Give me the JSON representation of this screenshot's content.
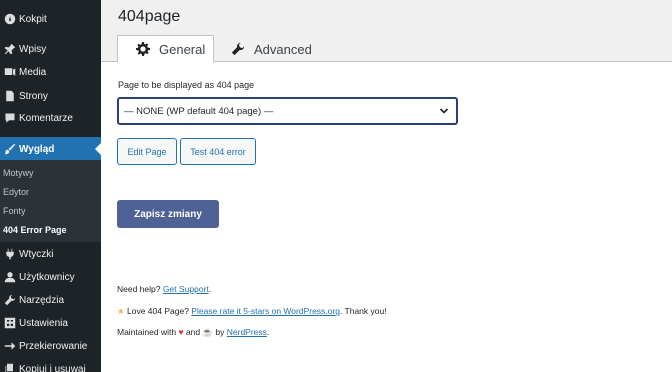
{
  "sidebar": {
    "items": [
      {
        "label": "Kokpit",
        "icon": "dashboard-icon"
      },
      {
        "label": "Wpisy",
        "icon": "pin-icon"
      },
      {
        "label": "Media",
        "icon": "media-icon"
      },
      {
        "label": "Strony",
        "icon": "page-icon"
      },
      {
        "label": "Komentarze",
        "icon": "comment-icon"
      },
      {
        "label": "Wygląd",
        "icon": "brush-icon"
      },
      {
        "label": "Wtyczki",
        "icon": "plugin-icon"
      },
      {
        "label": "Użytkownicy",
        "icon": "user-icon"
      },
      {
        "label": "Narzędzia",
        "icon": "wrench-icon"
      },
      {
        "label": "Ustawienia",
        "icon": "settings-icon"
      },
      {
        "label": "Przekierowanie",
        "icon": "redirect-icon"
      },
      {
        "label": "Kopiuj i usuwaj",
        "icon": "copy-icon"
      }
    ],
    "submenu": [
      "Motywy",
      "Edytor",
      "Fonty",
      "404 Error Page"
    ]
  },
  "header": {
    "title": "404page",
    "tabs": [
      {
        "label": "General",
        "icon": "gear-icon"
      },
      {
        "label": "Advanced",
        "icon": "wrench-icon"
      }
    ]
  },
  "form": {
    "field_label": "Page to be displayed as 404 page",
    "select_value": "— NONE (WP default 404 page) —",
    "edit_button": "Edit Page",
    "test_button": "Test 404 error",
    "save_button": "Zapisz zmiany"
  },
  "footer": {
    "help_prefix": "Need help?",
    "help_link": "Get Support",
    "help_suffix": ".",
    "love_prefix": "Love 404 Page?",
    "rate_link": "Please rate it 5-stars on WordPress.org",
    "love_suffix": ". Thank you!",
    "maintained_prefix": "Maintained with",
    "maintained_and": "and",
    "maintained_by": "by",
    "author_link": "NerdPress",
    "maintained_suffix": "."
  },
  "colors": {
    "sidebar_bg": "#1d2327",
    "accent": "#2271b1",
    "primary_button": "#4f6296",
    "select_border": "#2c3f7a"
  }
}
